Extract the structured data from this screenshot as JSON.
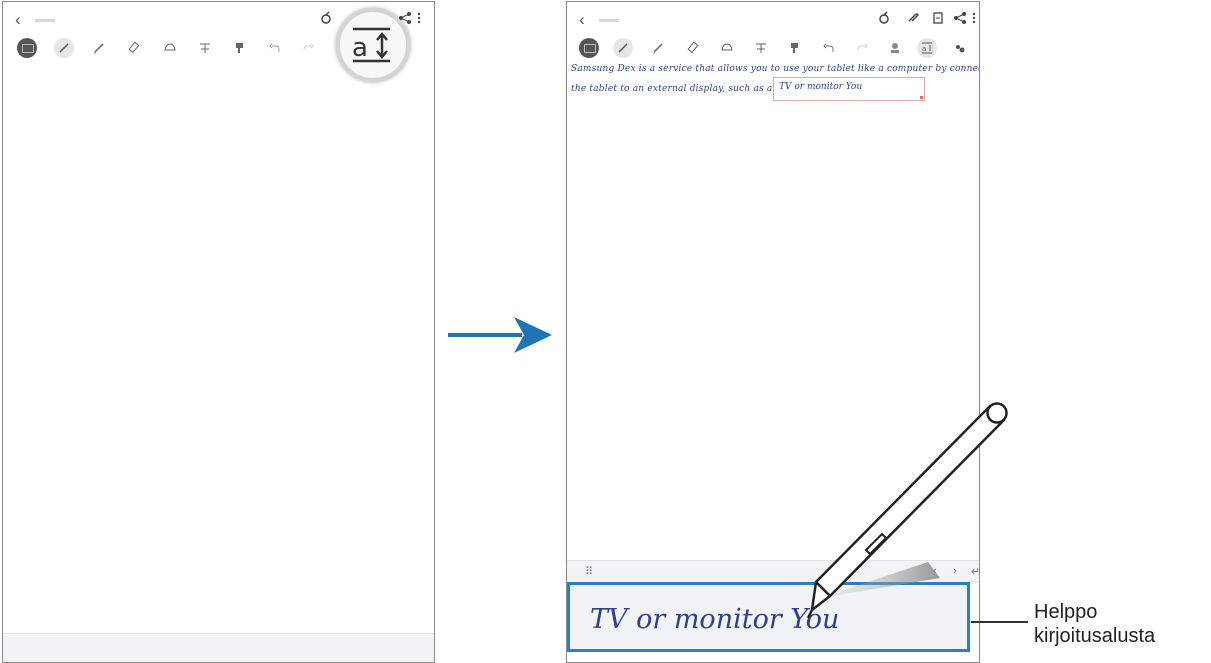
{
  "left_tablet": {
    "back_label": "‹",
    "magnifier_icon": "text-size-icon",
    "toolbar_icons": [
      "keyboard-icon",
      "pen-icon",
      "pencil-icon",
      "highlighter-icon",
      "lasso-icon",
      "text-icon",
      "brush-icon",
      "undo-icon",
      "redo-icon"
    ]
  },
  "right_tablet": {
    "back_label": "‹",
    "header_icons": [
      "reader-mode-icon",
      "attach-icon",
      "page-icon",
      "share-icon",
      "more-icon"
    ],
    "toolbar_icons": [
      "keyboard-icon",
      "pen-icon",
      "pencil-icon",
      "highlighter-icon",
      "lasso-icon",
      "text-icon",
      "brush-icon",
      "undo-icon",
      "redo-icon",
      "stamp-icon",
      "text-size-icon",
      "pen-settings-icon"
    ],
    "handwriting": {
      "line1": "Samsung Dex is a service that allows you to use your tablet like a computer by connecting",
      "line2": "the tablet to an external display, such as a",
      "selected_text": "TV or monitor You"
    },
    "pad_toolbar": {
      "left_icon": "⠿",
      "prev": "‹",
      "next": "›",
      "enter": "↵"
    },
    "pad_text": "TV or monitor You"
  },
  "callout": {
    "label_line1": "Helppo",
    "label_line2": "kirjoitusalusta"
  },
  "colors": {
    "arrow": "#1f73b7",
    "pad_border": "#2d7fc0",
    "ink": "#2e3f8f",
    "tablet_border": "#8a8a8a"
  }
}
